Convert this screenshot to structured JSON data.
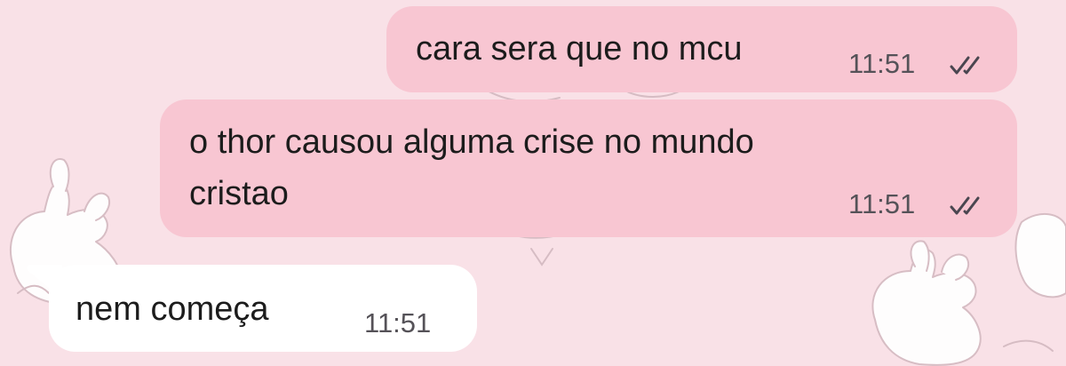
{
  "chat": {
    "messages": [
      {
        "direction": "outgoing",
        "text": "cara sera que no mcu",
        "time": "11:51",
        "status_icon": "read-double-check-icon"
      },
      {
        "direction": "outgoing",
        "text_lines": [
          "o thor causou alguma crise no mundo",
          "cristao"
        ],
        "time": "11:51",
        "status_icon": "read-double-check-icon"
      },
      {
        "direction": "incoming",
        "text": "nem começa",
        "time": "11:51"
      }
    ]
  },
  "colors": {
    "background": "#f9e1e7",
    "outgoing_bubble": "#f8c6d2",
    "incoming_bubble": "#ffffff",
    "text": "#1c1c1c",
    "meta": "#555258",
    "wallpaper_stroke": "#d9c2c8"
  },
  "wallpaper": {
    "pattern_icon": "bunny-doodle-pattern-icon"
  }
}
